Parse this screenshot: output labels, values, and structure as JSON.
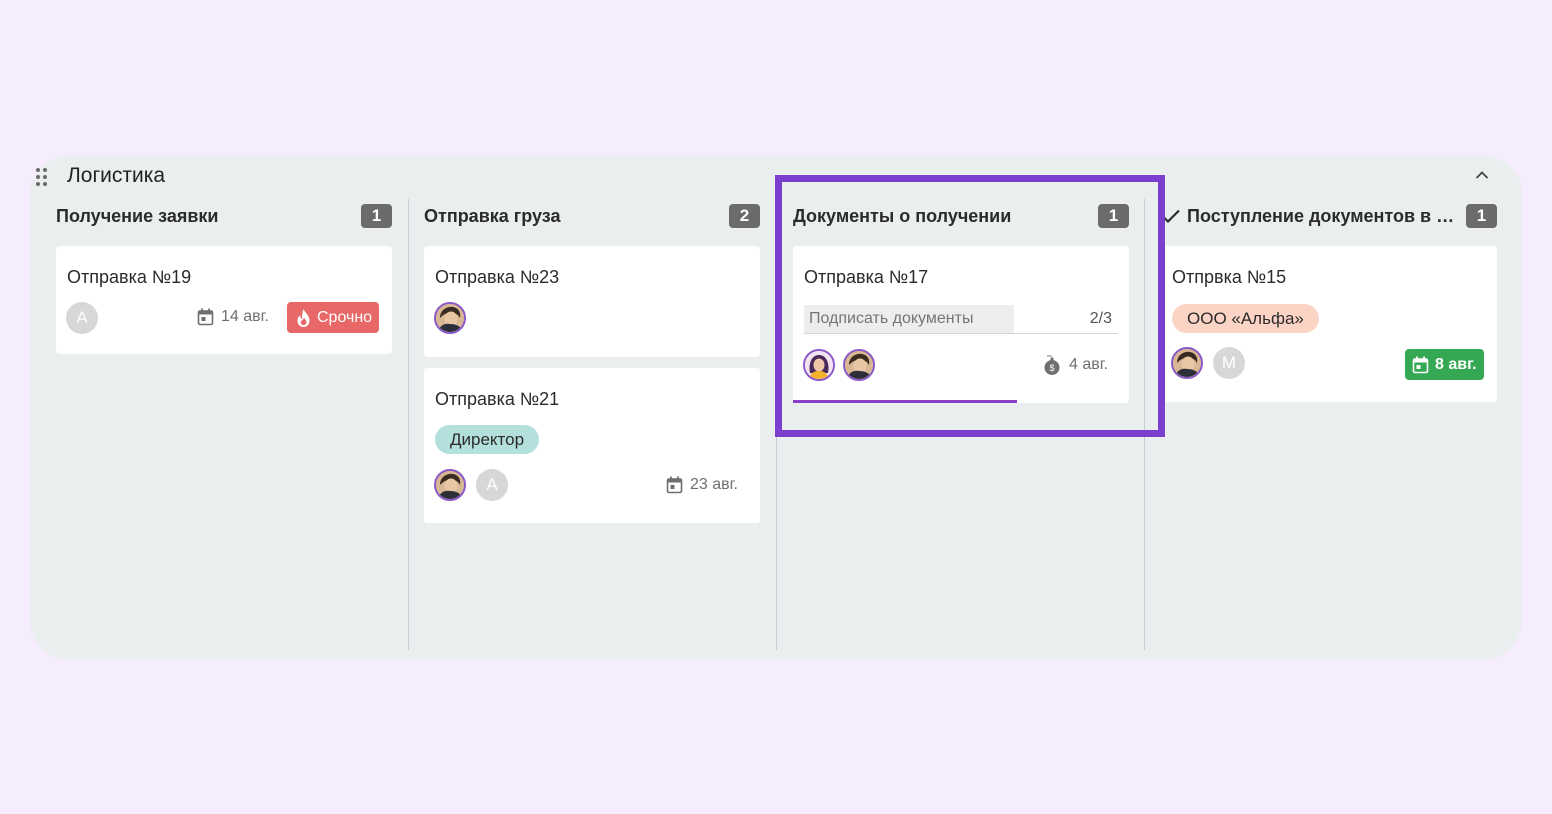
{
  "group": {
    "title": "Логистика",
    "collapse_icon": "chevron-up-icon",
    "drag_icon": "drag-handle-icon"
  },
  "columns": [
    {
      "title": "Получение заявки",
      "count": "1",
      "cards": [
        {
          "title": "Отправка №19",
          "avatar_letter": "А",
          "date": "14 авг.",
          "badge": "Срочно",
          "badge_color": "#e76866"
        }
      ]
    },
    {
      "title": "Отправка груза",
      "count": "2",
      "cards": [
        {
          "title": "Отправка №23"
        },
        {
          "title": "Отправка №21",
          "tag": "Директор",
          "tag_color": "#b3dfdc",
          "avatar_letter": "А",
          "date": "23 авг."
        }
      ]
    },
    {
      "title": "Документы о получении",
      "count": "1",
      "cards": [
        {
          "title": "Отправка №17",
          "checklist_label": "Подписать документы",
          "checklist_count": "2/3",
          "checklist_progress": 0.67,
          "date": "4 авг.",
          "date_icon": "bomb-icon"
        }
      ]
    },
    {
      "title": "Поступление документов в …",
      "count": "1",
      "done_icon": "checkmark-icon",
      "cards": [
        {
          "title": "Отпрвка №15",
          "tag": "ООО «Альфа»",
          "tag_color": "#fcd4c6",
          "avatar_letter": "М",
          "date": "8 авг.",
          "date_color": "#35a853"
        }
      ]
    }
  ],
  "colors": {
    "background": "#f5ecfd",
    "board": "#eaeeef",
    "accent": "#7b3fd0",
    "count_badge": "#6b6b6b"
  }
}
